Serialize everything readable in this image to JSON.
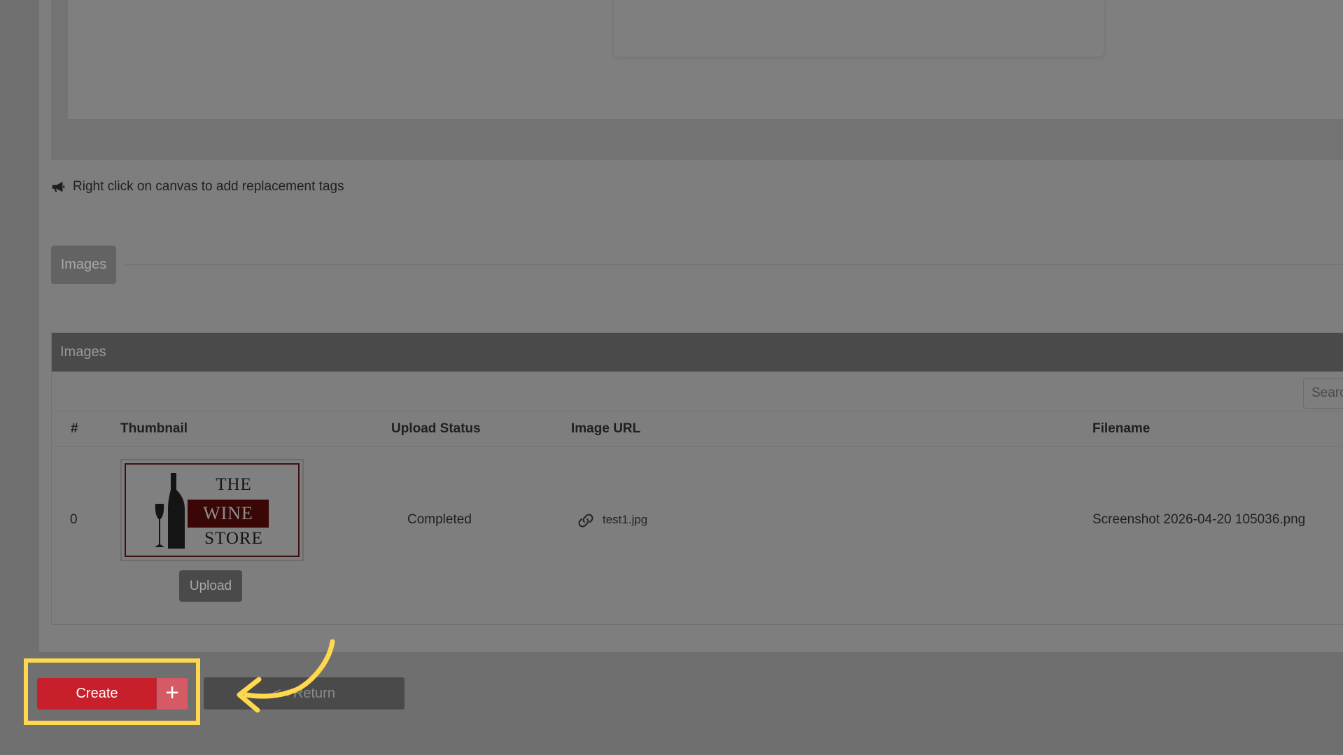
{
  "hint": {
    "text": "Right click on canvas to add replacement tags"
  },
  "section_tab": {
    "label": "Images"
  },
  "images_panel": {
    "title": "Images",
    "search_placeholder": "Search",
    "columns": [
      "#",
      "Thumbnail",
      "Upload Status",
      "Image URL",
      "Filename"
    ],
    "rows": [
      {
        "index": "0",
        "thumbnail_logo": [
          "THE",
          "WINE",
          "STORE"
        ],
        "upload_label": "Upload",
        "upload_status": "Completed",
        "image_url": "test1.jpg",
        "filename": "Screenshot 2026-04-20 105036.png"
      }
    ]
  },
  "actions": {
    "create_label": "Create",
    "create_icon": "+",
    "return_label": "<< Return"
  },
  "colors": {
    "create_red": "#c8202b",
    "highlight_yellow": "#ffd84d"
  }
}
